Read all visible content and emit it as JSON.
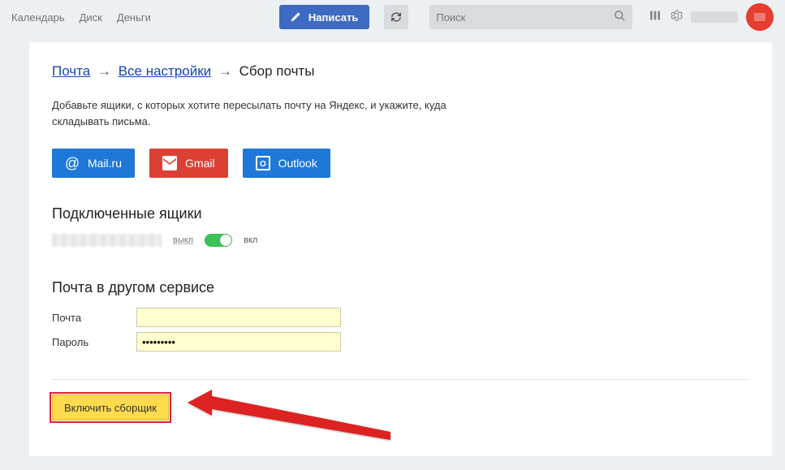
{
  "topbar": {
    "links": [
      "Календарь",
      "Диск",
      "Деньги"
    ],
    "compose_label": "Написать",
    "search_placeholder": "Поиск"
  },
  "breadcrumb": {
    "mail": "Почта",
    "settings": "Все настройки",
    "current": "Сбор почты",
    "sep": "→"
  },
  "description": "Добавьте ящики, с которых хотите пересылать почту на Яндекс, и укажите, куда складывать письма.",
  "providers": {
    "mailru": "Mail.ru",
    "gmail": "Gmail",
    "outlook": "Outlook"
  },
  "sections": {
    "connected": "Подключенные ящики",
    "other_service": "Почта в другом сервисе"
  },
  "toggle": {
    "off": "выкл",
    "on": "вкл"
  },
  "form": {
    "email_label": "Почта",
    "password_label": "Пароль",
    "email_value": "",
    "password_value": "•••••••••"
  },
  "enable_button": "Включить сборщик"
}
